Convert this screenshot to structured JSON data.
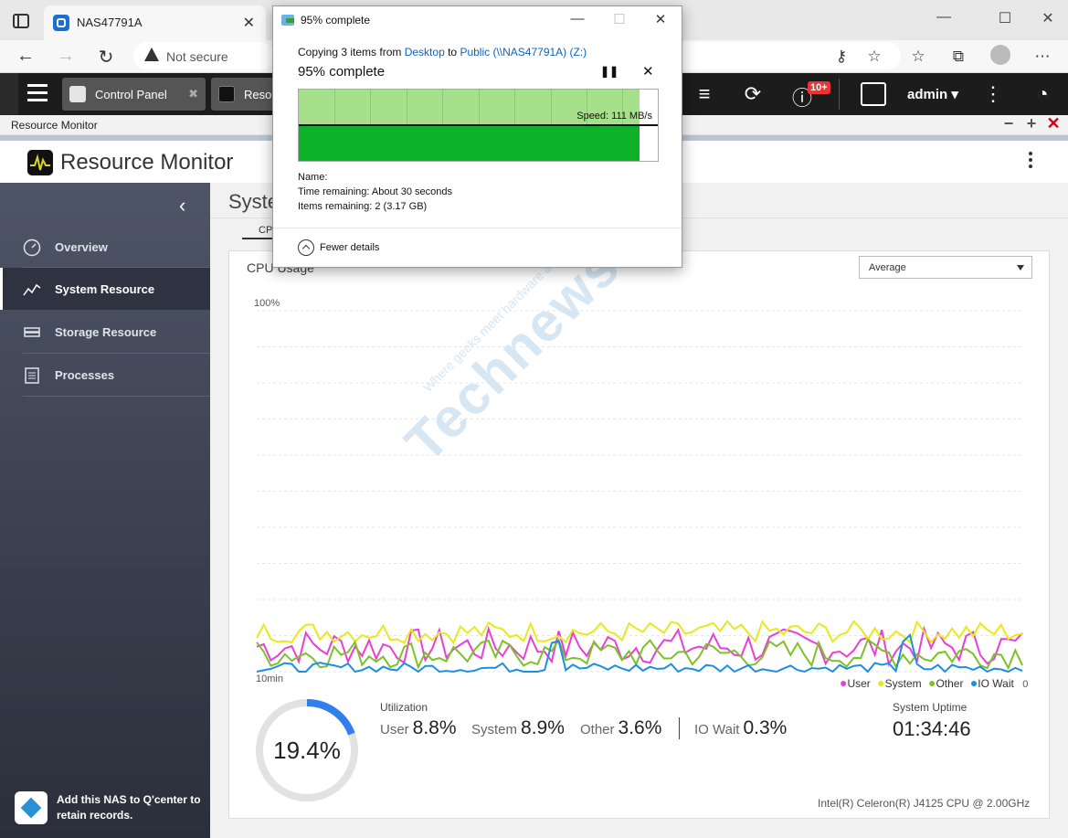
{
  "browser": {
    "tab_title": "NAS47791A",
    "security_label": "Not secure"
  },
  "qts": {
    "tabs": [
      {
        "label": "Control Panel"
      },
      {
        "label": "Resou"
      }
    ],
    "notification_badge": "10+",
    "username": "admin"
  },
  "app": {
    "window_title": "Resource Monitor",
    "name": "Resource Monitor"
  },
  "sidebar": {
    "items": [
      {
        "label": "Overview"
      },
      {
        "label": "System Resource"
      },
      {
        "label": "Storage Resource"
      },
      {
        "label": "Processes"
      }
    ],
    "qcenter_text": "Add this NAS to Q'center to retain records."
  },
  "main": {
    "page_title": "Syste",
    "subtab": "CPU",
    "card_title": "CPU Usage",
    "dropdown_value": "Average"
  },
  "chart_data": {
    "type": "line",
    "ylim": [
      0,
      100
    ],
    "y_top_label": "100%",
    "x_left_label": "10min",
    "x_right_label": "0",
    "series": [
      {
        "name": "User",
        "color": "#e83fd6"
      },
      {
        "name": "System",
        "color": "#e8e81a"
      },
      {
        "name": "Other",
        "color": "#7dc225"
      },
      {
        "name": "IO Wait",
        "color": "#1a8fe3"
      }
    ]
  },
  "stats": {
    "gauge_value": "19.4%",
    "gauge_fraction": 0.194,
    "utilization_title": "Utilization",
    "user_label": "User",
    "user_value": "8.8%",
    "system_label": "System",
    "system_value": "8.9%",
    "other_label": "Other",
    "other_value": "3.6%",
    "iowait_label": "IO Wait",
    "iowait_value": "0.3%",
    "uptime_title": "System Uptime",
    "uptime_value": "01:34:46",
    "cpu_model": "Intel(R) Celeron(R) J4125 CPU @ 2.00GHz"
  },
  "watermark": {
    "main": "Technews.lt",
    "tagline": "Where geeks meet hardware and software"
  },
  "dialog": {
    "title": "95% complete",
    "copying_prefix": "Copying 3 items from ",
    "source": "Desktop",
    "to_word": " to ",
    "destination": "Public (\\\\NAS47791A) (Z:)",
    "heading": "95% complete",
    "progress_fraction": 0.95,
    "speed": "Speed: 111 MB/s",
    "name_label": "Name:",
    "time_remaining": "Time remaining:  About 30 seconds",
    "items_remaining": "Items remaining:  2 (3.17 GB)",
    "fewer_details": "Fewer details"
  }
}
